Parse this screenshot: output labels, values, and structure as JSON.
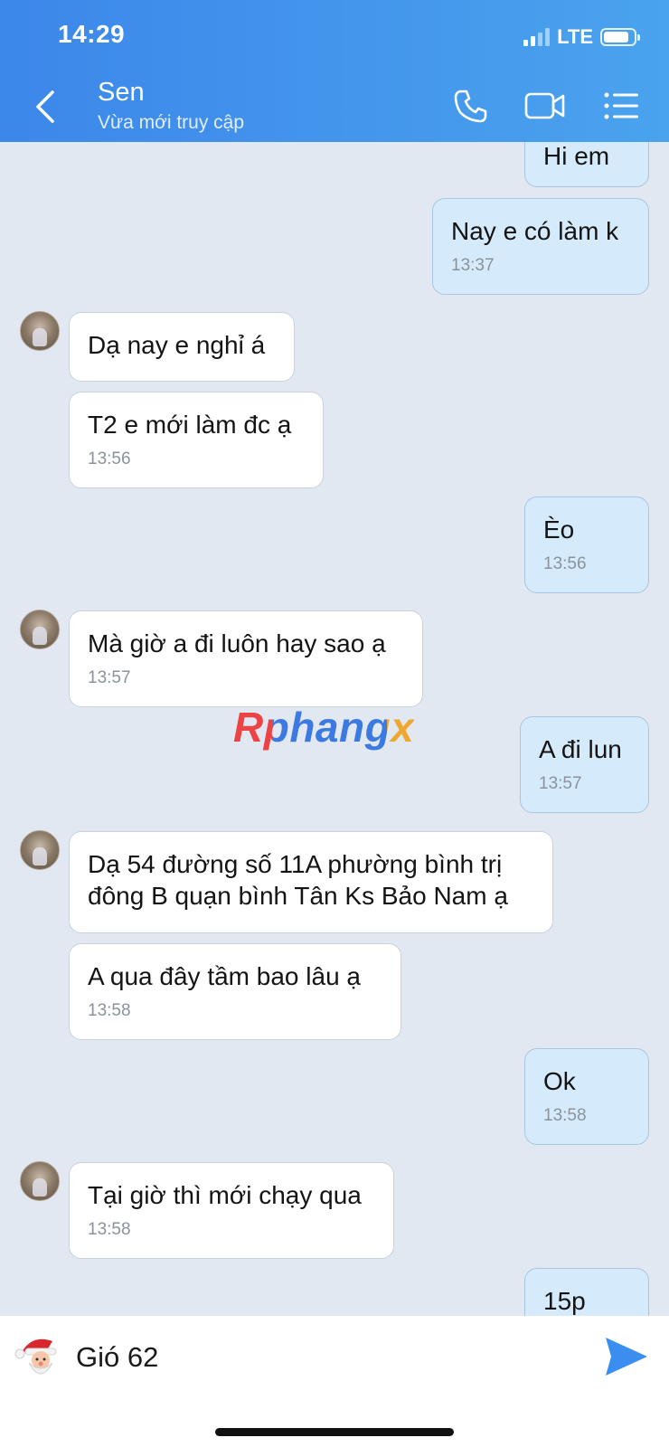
{
  "status_bar": {
    "time": "14:29",
    "network": "LTE",
    "battery_level": 0.85
  },
  "header": {
    "name": "Sen",
    "status": "Vừa mới truy cập"
  },
  "messages": [
    {
      "dir": "out",
      "text": "Hi em",
      "time": ""
    },
    {
      "dir": "out",
      "text": "Nay e có làm k",
      "time": "13:37"
    },
    {
      "dir": "in",
      "text": "Dạ nay e nghỉ á",
      "time": ""
    },
    {
      "dir": "in",
      "text": "T2 e mới làm đc ạ",
      "time": "13:56"
    },
    {
      "dir": "out",
      "text": "Èo",
      "time": "13:56"
    },
    {
      "dir": "in",
      "text": "Mà giờ a đi luôn hay sao ạ",
      "time": "13:57"
    },
    {
      "dir": "out",
      "text": "A đi lun",
      "time": "13:57"
    },
    {
      "dir": "in",
      "text": "Dạ 54 đường số 11A phường bình trị đông B quạn bình Tân Ks Bảo Nam ạ",
      "time": ""
    },
    {
      "dir": "in",
      "text": "A qua đây tầm bao lâu ạ",
      "time": "13:58"
    },
    {
      "dir": "out",
      "text": "Ok",
      "time": "13:58"
    },
    {
      "dir": "in",
      "text": "Tại giờ thì mới chạy qua",
      "time": "13:58"
    },
    {
      "dir": "out",
      "text": "15p",
      "time": ""
    }
  ],
  "watermark": "Rphangx",
  "input": {
    "text": "Gió 62"
  },
  "icons": {
    "back": "chevron-left-icon",
    "call": "phone-icon",
    "video": "video-camera-icon",
    "menu": "list-menu-icon",
    "send": "send-arrow-icon",
    "sticker": "santa-sticker-icon"
  },
  "colors": {
    "header_start": "#3c87ea",
    "header_end": "#4aa3ee",
    "outgoing_bubble": "#d5ebfb",
    "incoming_bubble": "#ffffff",
    "chat_bg": "#e2e8f1",
    "send": "#3a8ef0"
  }
}
